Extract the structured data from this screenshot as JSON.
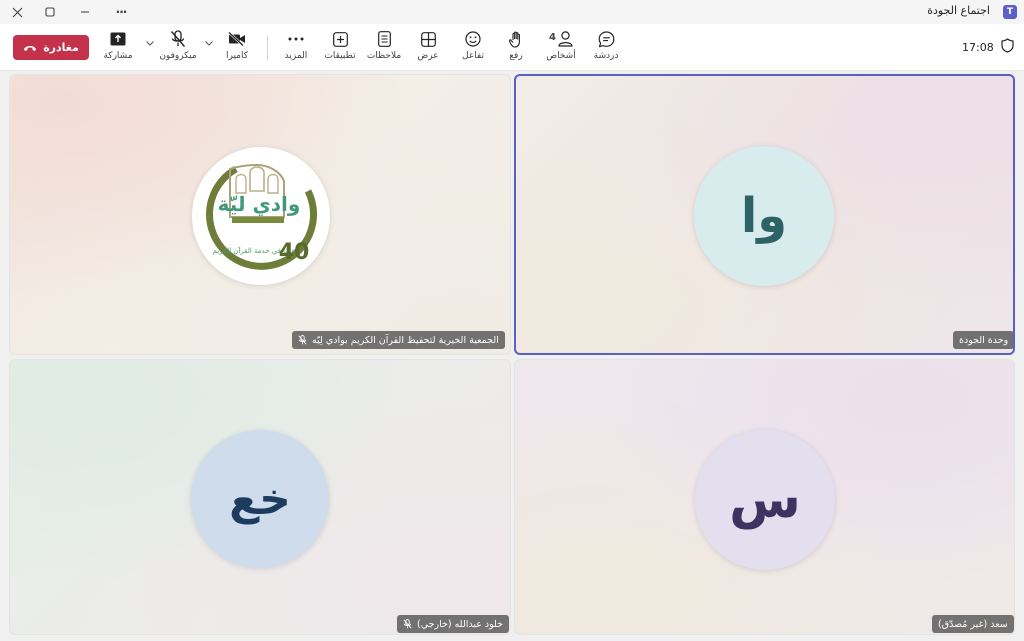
{
  "window": {
    "title": "اجتماع الجودة",
    "more_glyph": "···"
  },
  "toolbar": {
    "leave_label": "مغادرة",
    "share_label": "مشاركة",
    "mic_label": "ميكروفون",
    "camera_label": "كاميرا",
    "more_label": "المزيد",
    "apps_label": "تطبيقات",
    "notes_label": "ملاحظات",
    "view_label": "عرض",
    "react_label": "تفاعل",
    "raise_label": "رفع",
    "people_label": "أشخاص",
    "people_count": "4",
    "chat_label": "دردشة",
    "time": "17:08"
  },
  "participants": [
    {
      "name": "الجمعية الخيرية لتحفيظ القرآن الكريم بوادي لِيّه",
      "initials": "",
      "logo_text": "وادي ليّة",
      "logo_tagline": "عامًا في خدمة القرآن الكريم",
      "logo_number": "40",
      "muted": true
    },
    {
      "name": "وحدة الجودة",
      "initials": "وا",
      "muted": false,
      "active": true
    },
    {
      "name": "خلود عبدالله (خارجي)",
      "initials": "خع",
      "muted": true
    },
    {
      "name": "سعد (غير مُصدّق)",
      "initials": "س",
      "muted": false
    }
  ],
  "colors": {
    "leave": "#c4314b",
    "active_border": "#5b5fc7",
    "avatar_wa_bg": "#d8ecee",
    "avatar_wa_fg": "#2e6267",
    "avatar_kh_bg": "#cfdcec",
    "avatar_kh_fg": "#1d3a5f",
    "avatar_s_bg": "#e4dfee",
    "avatar_s_fg": "#3d3360"
  },
  "icons": {
    "close": "close-icon",
    "maximize": "maximize-icon",
    "minimize": "minimize-icon",
    "more": "more-icon",
    "share": "share-icon",
    "mic_off": "mic-off-icon",
    "camera_off": "camera-off-icon",
    "apps": "apps-icon",
    "notes": "notes-icon",
    "view": "view-grid-icon",
    "react": "emoji-icon",
    "raise": "hand-icon",
    "people": "people-icon",
    "chat": "chat-icon",
    "shield": "shield-icon",
    "phone": "phone-hangup-icon"
  }
}
